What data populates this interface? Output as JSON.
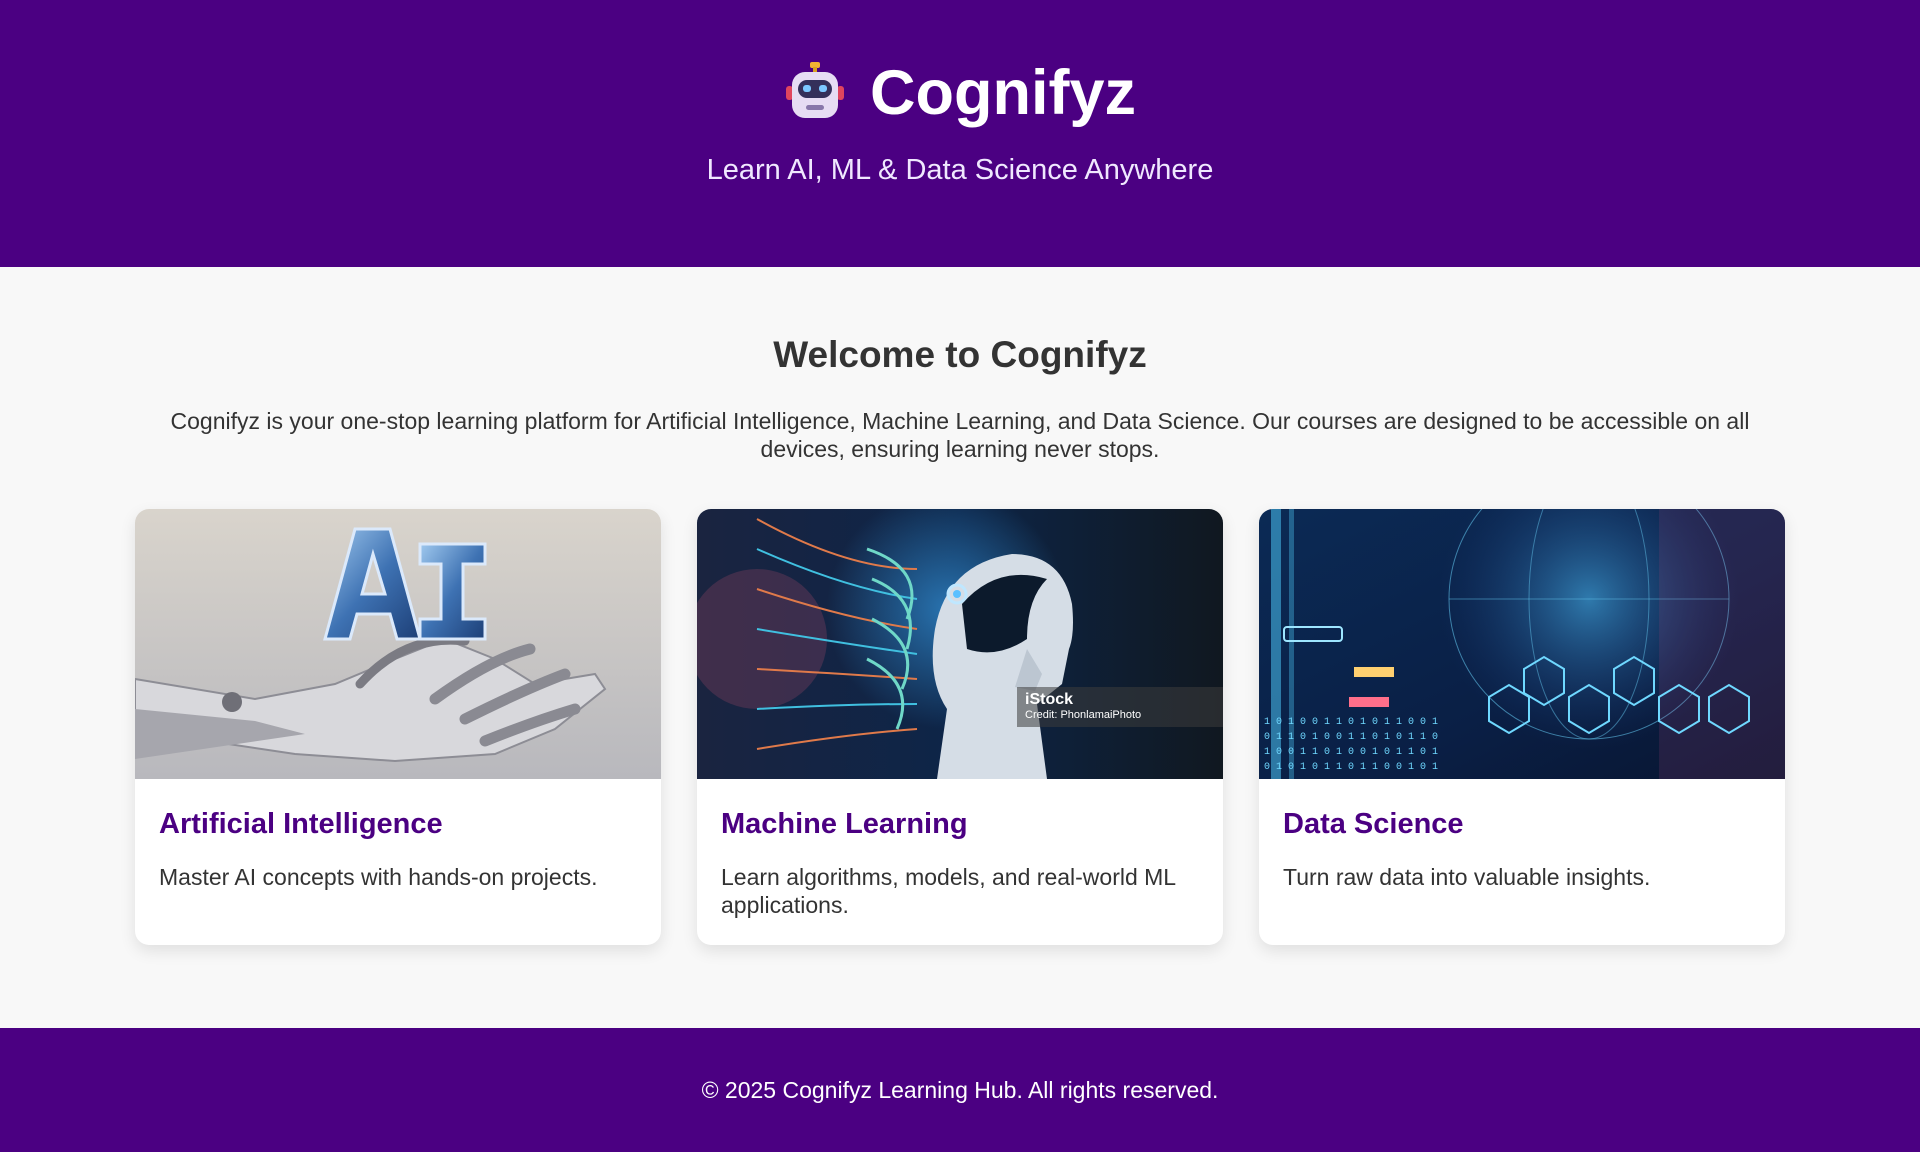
{
  "header": {
    "title": "Cognifyz",
    "tagline": "Learn AI, ML & Data Science Anywhere",
    "logo_icon": "robot-icon",
    "background": "#4b0082"
  },
  "main": {
    "heading": "Welcome to Cognifyz",
    "intro": "Cognifyz is your one-stop learning platform for Artificial Intelligence, Machine Learning, and Data Science. Our courses are designed to be accessible on all devices, ensuring learning never stops.",
    "cards": [
      {
        "title": "Artificial Intelligence",
        "description": "Master AI concepts with hands-on projects.",
        "image": "robotic-hand-holding-ai-letters"
      },
      {
        "title": "Machine Learning",
        "description": "Learn algorithms, models, and real-world ML applications.",
        "image": "humanoid-robot-with-neural-network",
        "watermark_brand": "iStock",
        "watermark_credit": "Credit: PhonlamaiPhoto"
      },
      {
        "title": "Data Science",
        "description": "Turn raw data into valuable insights.",
        "image": "digital-globe-with-data-icons"
      }
    ]
  },
  "footer": {
    "text": "© 2025 Cognifyz Learning Hub. All rights reserved."
  },
  "colors": {
    "brand_purple": "#4b0082",
    "card_title": "#4b0082",
    "body_text": "#333333",
    "page_background": "#f8f8f8"
  }
}
